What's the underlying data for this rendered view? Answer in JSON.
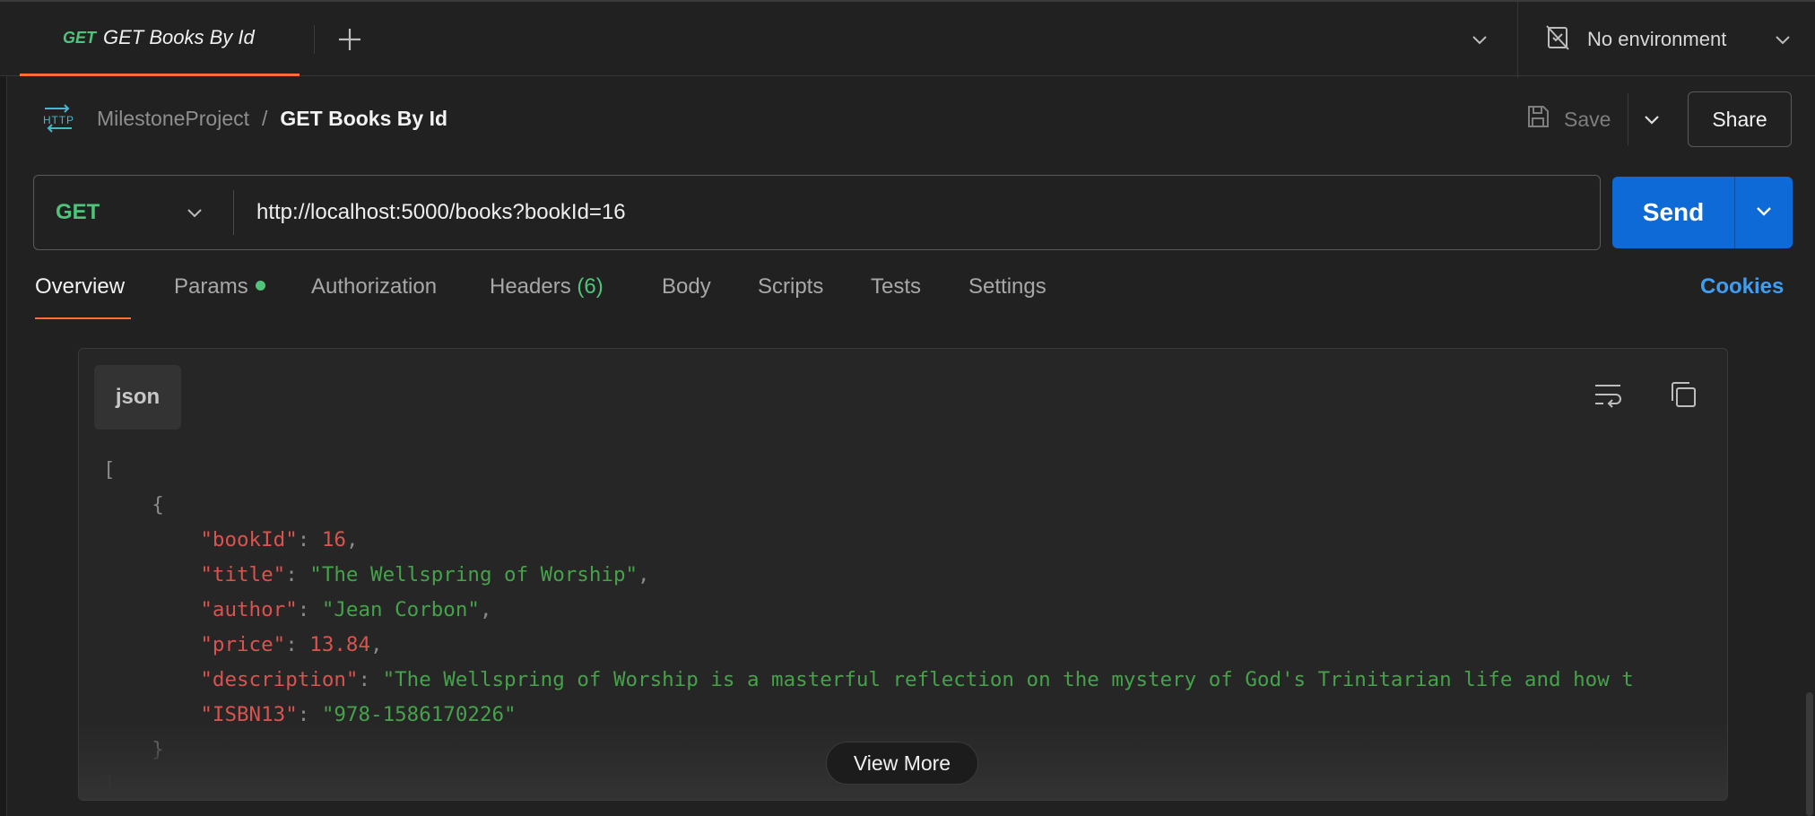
{
  "tabbar": {
    "active_tab": {
      "method": "GET",
      "title": "GET Books By Id"
    },
    "environment": "No environment"
  },
  "breadcrumb": {
    "collection": "MilestoneProject",
    "separator": "/",
    "request": "GET Books By Id"
  },
  "actions": {
    "save_label": "Save",
    "share_label": "Share"
  },
  "request": {
    "method": "GET",
    "url": "http://localhost:5000/books?bookId=16",
    "send_label": "Send"
  },
  "request_tabs": {
    "overview": "Overview",
    "params": "Params",
    "authorization": "Authorization",
    "headers": "Headers",
    "headers_count": "(6)",
    "body": "Body",
    "scripts": "Scripts",
    "tests": "Tests",
    "settings": "Settings",
    "cookies": "Cookies"
  },
  "response_panel": {
    "language": "json",
    "view_more": "View More",
    "json": {
      "open_bracket": "[",
      "open_brace": "{",
      "close_brace": "}",
      "close_bracket": "]",
      "fields": [
        {
          "key": "\"bookId\"",
          "value": "16",
          "type": "number",
          "comma": ","
        },
        {
          "key": "\"title\"",
          "value": "\"The Wellspring of Worship\"",
          "type": "string",
          "comma": ","
        },
        {
          "key": "\"author\"",
          "value": "\"Jean Corbon\"",
          "type": "string",
          "comma": ","
        },
        {
          "key": "\"price\"",
          "value": "13.84",
          "type": "number",
          "comma": ","
        },
        {
          "key": "\"description\"",
          "value": "\"The Wellspring of Worship is a masterful reflection on the mystery of God's Trinitarian life and how t",
          "type": "string",
          "comma": ""
        },
        {
          "key": "\"ISBN13\"",
          "value": "\"978-1586170226\"",
          "type": "string",
          "comma": ""
        }
      ]
    }
  },
  "colors": {
    "accent": "#ff6c37",
    "send": "#0e6ad6",
    "method_get": "#4fc47a",
    "json_key": "#d9534f",
    "json_string": "#46a24a",
    "link": "#3f9ef2"
  },
  "icons": [
    "plus-icon",
    "chevron-down-icon",
    "no-environment-icon",
    "http-icon",
    "save-icon",
    "wrap-lines-icon",
    "copy-icon"
  ]
}
